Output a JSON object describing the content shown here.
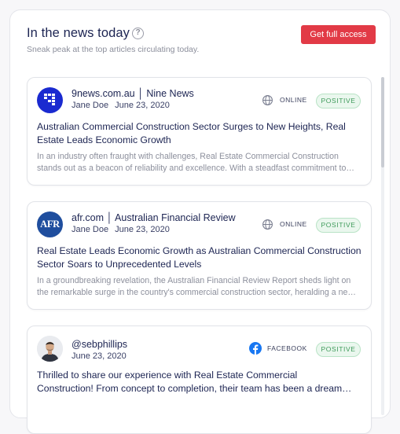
{
  "header": {
    "title": "In the news today",
    "subtitle": "Sneak peak at the top articles circulating today.",
    "cta_label": "Get full access"
  },
  "articles": [
    {
      "source": "9news.com.au  │  Nine News",
      "author": "Jane Doe",
      "date": "June 23, 2020",
      "channel": "ONLINE",
      "sentiment": "POSITIVE",
      "headline": "Australian Commercial Construction Sector Surges to New Heights, Real Estate Leads Economic Growth",
      "excerpt_line1": "In an industry often fraught with challenges, Real Estate Commercial Construction",
      "excerpt_line2": "stands out as a beacon of reliability and excellence. With a steadfast commitment to…",
      "logo_text": "9 NEWS"
    },
    {
      "source": "afr.com │ Australian Financial Review",
      "author": "Jane Doe",
      "date": "June 23, 2020",
      "channel": "ONLINE",
      "sentiment": "POSITIVE",
      "headline": "Real Estate Leads Economic Growth as Australian Commercial Construction Sector Soars to Unprecedented Levels",
      "excerpt_line1": "In a groundbreaking revelation, the Australian Financial Review Report sheds light on",
      "excerpt_line2": "the remarkable surge in the country's commercial construction sector, heralding a ne…",
      "logo_text": "AFR"
    },
    {
      "source": "@sebphillips",
      "date": "June 23, 2020",
      "channel": "FACEBOOK",
      "sentiment": "POSITIVE",
      "headline_line1": "Thrilled to share our experience with Real Estate Commercial",
      "headline_line2": "Construction! From concept to completion, their team has been a dream…"
    }
  ],
  "colors": {
    "accent": "#e23a46",
    "positive_text": "#3e9a5a",
    "positive_bg": "#eaf7ee",
    "facebook": "#1877f2",
    "nine_news_blue": "#1a2ad0",
    "afr_blue": "#1f4e9e"
  }
}
